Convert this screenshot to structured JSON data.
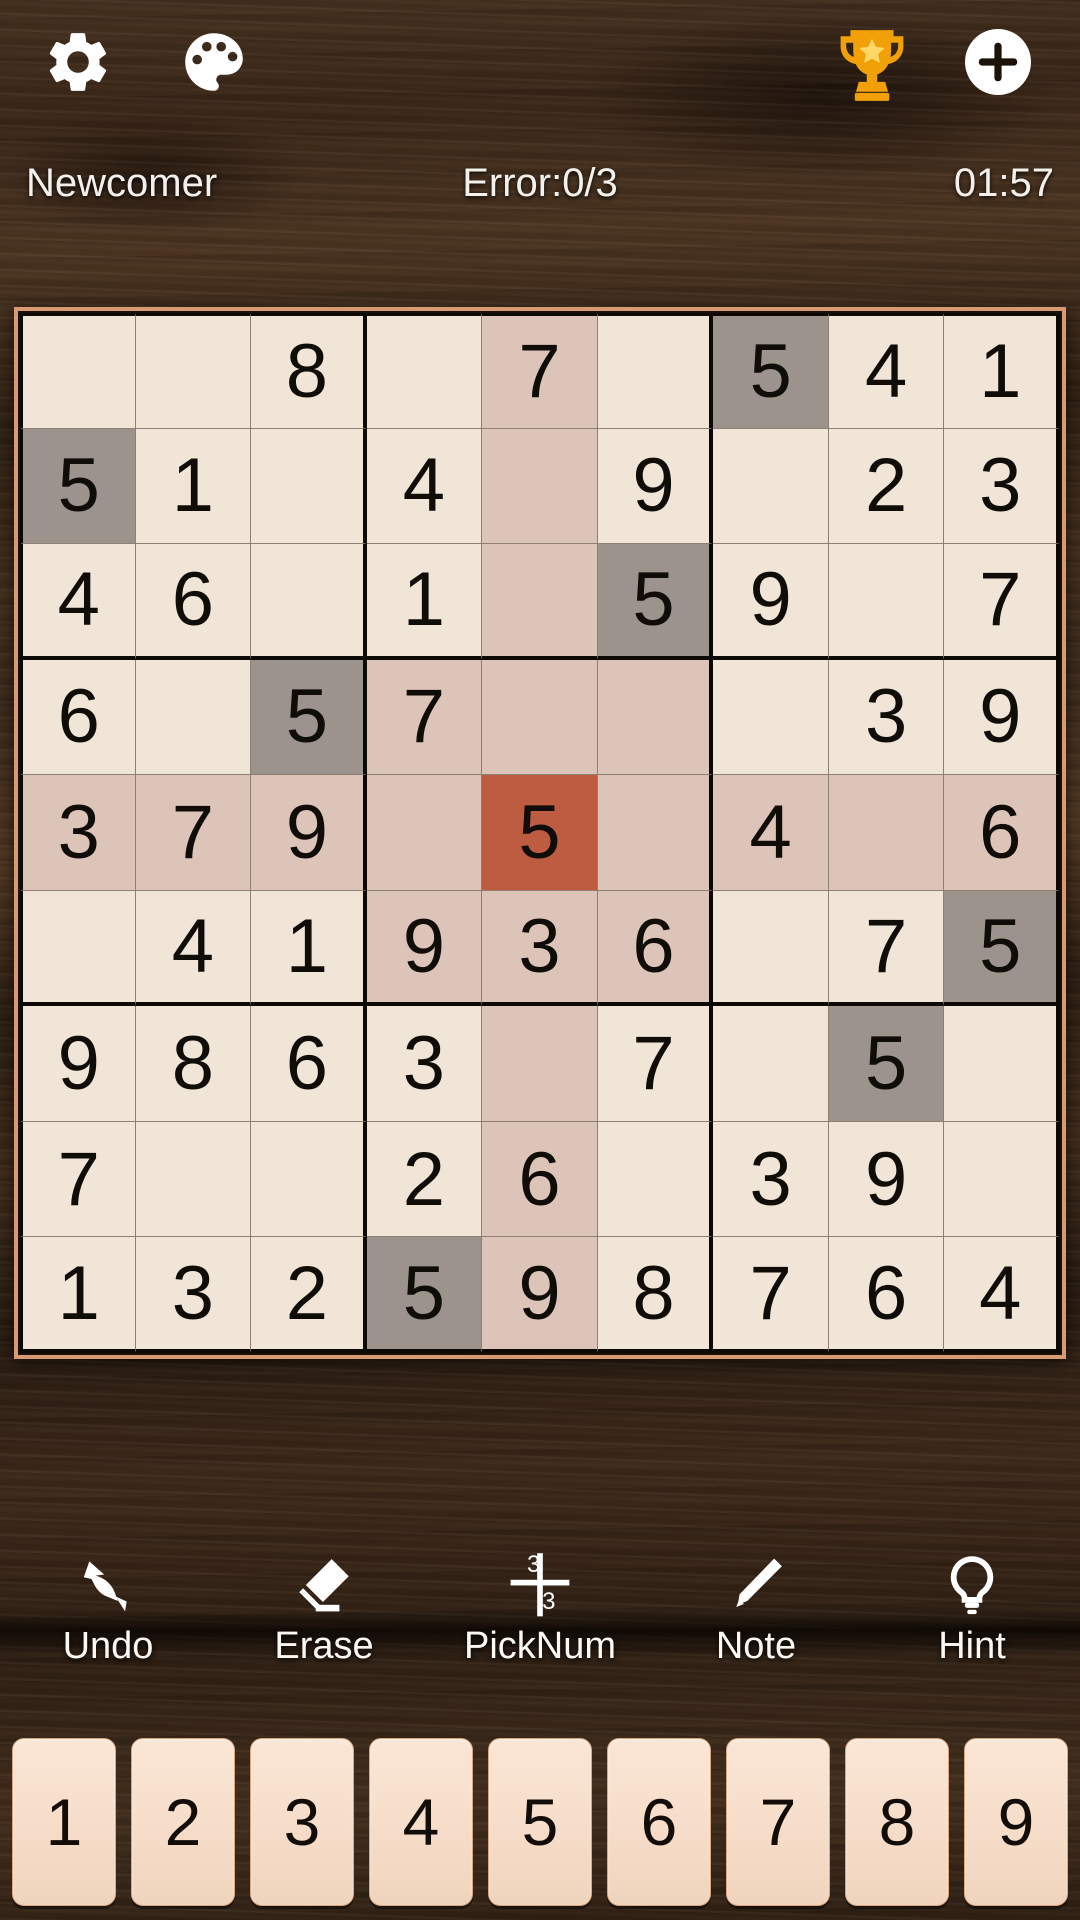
{
  "topbar": {
    "settings_icon": "gear-icon",
    "theme_icon": "palette-icon",
    "trophy_icon": "trophy-icon",
    "add_icon": "plus-icon"
  },
  "status": {
    "difficulty": "Newcomer",
    "errors": "Error:0/3",
    "timer": "01:57"
  },
  "board": {
    "selected": {
      "row": 4,
      "col": 4,
      "value": "5"
    },
    "highlight_value": "5",
    "colors": {
      "cell_bg": "#f1e5d8",
      "peer_bg": "#ddc4b8",
      "same_value_bg": "#9b938c",
      "selected_bg": "#bd5c40",
      "frame_border": "#d89a72",
      "grid_line": "#0d0906",
      "digit": "#100c08"
    },
    "rows": [
      [
        "",
        "",
        "8",
        "",
        "7",
        "",
        "5",
        "4",
        "1"
      ],
      [
        "5",
        "1",
        "",
        "4",
        "",
        "9",
        "",
        "2",
        "3"
      ],
      [
        "4",
        "6",
        "",
        "1",
        "",
        "5",
        "9",
        "",
        "7"
      ],
      [
        "6",
        "",
        "5",
        "7",
        "",
        "",
        "",
        "3",
        "9"
      ],
      [
        "3",
        "7",
        "9",
        "",
        "5",
        "",
        "4",
        "",
        "6"
      ],
      [
        "",
        "4",
        "1",
        "9",
        "3",
        "6",
        "",
        "7",
        "5"
      ],
      [
        "9",
        "8",
        "6",
        "3",
        "",
        "7",
        "",
        "5",
        ""
      ],
      [
        "7",
        "",
        "",
        "2",
        "6",
        "",
        "3",
        "9",
        ""
      ],
      [
        "1",
        "3",
        "2",
        "5",
        "9",
        "8",
        "7",
        "6",
        "4"
      ]
    ],
    "cell_states": [
      [
        "plain",
        "plain",
        "plain",
        "plain",
        "peer",
        "plain",
        "same",
        "plain",
        "plain"
      ],
      [
        "same",
        "plain",
        "plain",
        "plain",
        "peer",
        "plain",
        "plain",
        "plain",
        "plain"
      ],
      [
        "plain",
        "plain",
        "plain",
        "plain",
        "peer",
        "same",
        "plain",
        "plain",
        "plain"
      ],
      [
        "plain",
        "plain",
        "same",
        "peer",
        "peer",
        "peer",
        "plain",
        "plain",
        "plain"
      ],
      [
        "peer",
        "peer",
        "peer",
        "peer",
        "sel",
        "peer",
        "peer",
        "peer",
        "peer"
      ],
      [
        "plain",
        "plain",
        "plain",
        "peer",
        "peer",
        "peer",
        "plain",
        "plain",
        "same"
      ],
      [
        "plain",
        "plain",
        "plain",
        "plain",
        "peer",
        "plain",
        "plain",
        "same",
        "plain"
      ],
      [
        "plain",
        "plain",
        "plain",
        "plain",
        "peer",
        "plain",
        "plain",
        "plain",
        "plain"
      ],
      [
        "plain",
        "plain",
        "plain",
        "same",
        "peer",
        "plain",
        "plain",
        "plain",
        "plain"
      ]
    ]
  },
  "actions": [
    {
      "label": "Undo",
      "icon": "undo-arrow-icon"
    },
    {
      "label": "Erase",
      "icon": "eraser-icon"
    },
    {
      "label": "PickNum",
      "icon": "picknum-fraction-icon",
      "icon_top": "3",
      "icon_bottom": "3"
    },
    {
      "label": "Note",
      "icon": "pencil-icon"
    },
    {
      "label": "Hint",
      "icon": "lightbulb-icon"
    }
  ],
  "numpad": {
    "keys": [
      "1",
      "2",
      "3",
      "4",
      "5",
      "6",
      "7",
      "8",
      "9"
    ]
  }
}
